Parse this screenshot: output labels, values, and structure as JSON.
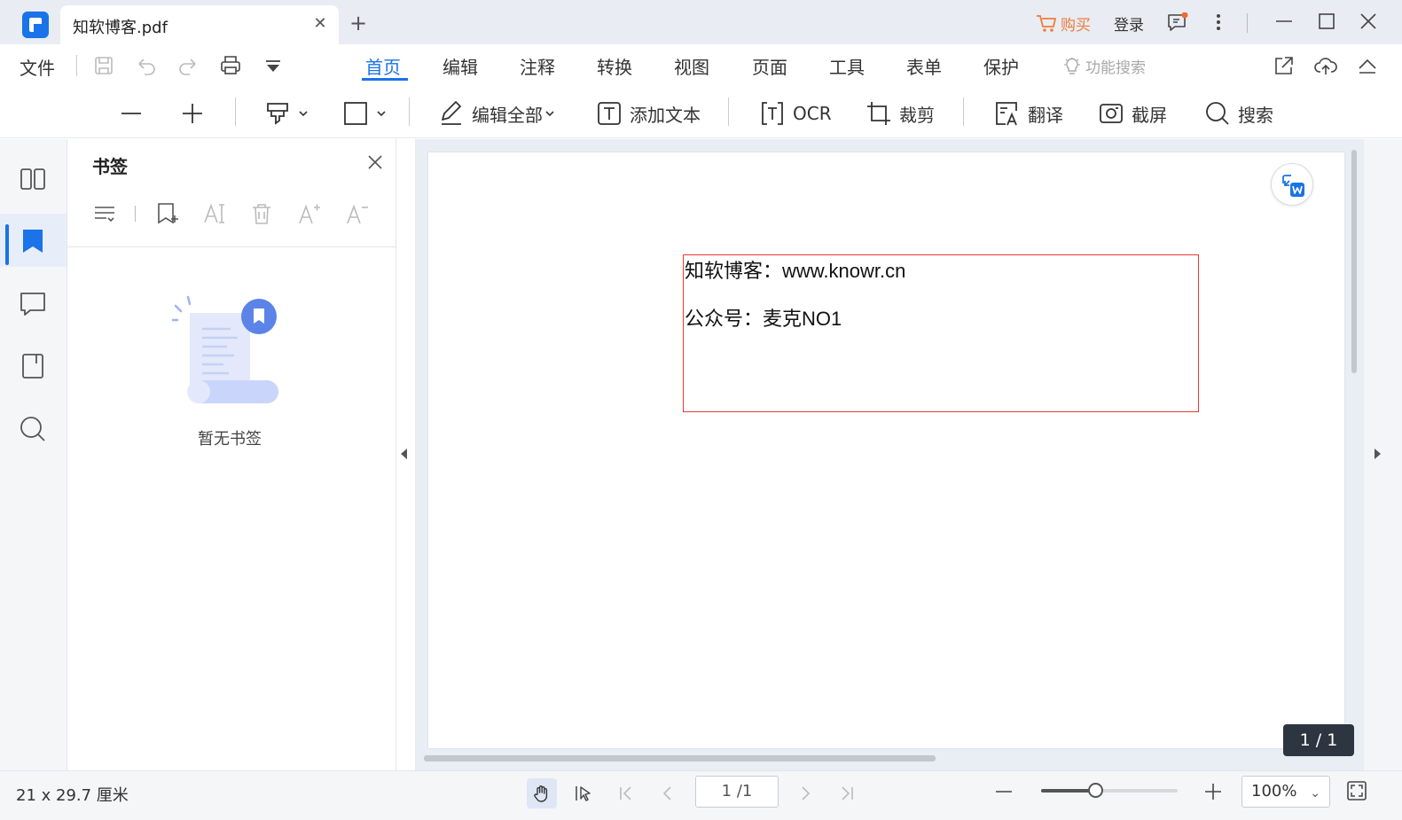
{
  "titlebar": {
    "doc_tab_title": "知软博客.pdf",
    "buy_label": "购买",
    "login_label": "登录"
  },
  "menubar": {
    "file_label": "文件",
    "tabs": [
      "首页",
      "编辑",
      "注释",
      "转换",
      "视图",
      "页面",
      "工具",
      "表单",
      "保护"
    ],
    "active_tab": "首页",
    "feature_search_label": "功能搜索"
  },
  "toolbar": {
    "edit_all_label": "编辑全部",
    "add_text_label": "添加文本",
    "ocr_label": "OCR",
    "crop_label": "裁剪",
    "translate_label": "翻译",
    "screenshot_label": "截屏",
    "search_label": "搜索"
  },
  "sidebar": {
    "active_item": "bookmarks",
    "panel_title": "书签",
    "empty_text": "暂无书签"
  },
  "document": {
    "line1": "知软博客：www.knowr.cn",
    "line2": "公众号：麦克NO1",
    "page_counter": "1 / 1"
  },
  "statusbar": {
    "page_size": "21 x 29.7 厘米",
    "page_input": "1 /1",
    "zoom_value": "100%",
    "zoom_fraction": 0.4
  },
  "colors": {
    "accent": "#1a73e8",
    "buy": "#f07b3c",
    "textbox_border": "#e53935"
  }
}
